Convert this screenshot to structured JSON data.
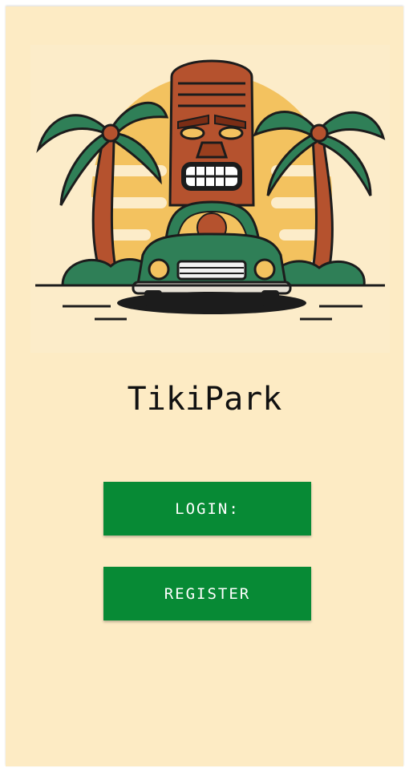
{
  "app": {
    "title": "TikiPark"
  },
  "actions": {
    "login_label": "LOGIN:",
    "register_label": "REGISTER"
  },
  "colors": {
    "background": "#fdebc4",
    "button": "#078a35",
    "button_text": "#ffffff",
    "title_text": "#111111"
  },
  "illustration": {
    "icon": "tiki-car-palm-logo"
  }
}
